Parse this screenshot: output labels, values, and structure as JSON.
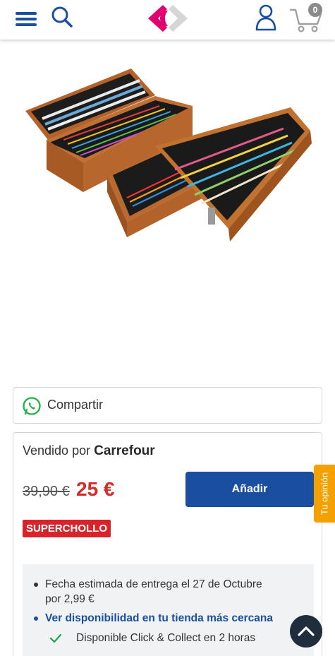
{
  "header": {
    "cart_count": "0"
  },
  "share": {
    "label": "Compartir"
  },
  "seller": {
    "prefix": "Vendido por",
    "name": "Carrefour"
  },
  "price": {
    "old": "39,90 €",
    "current": "25 €"
  },
  "add_button": "Añadir",
  "badge": "SUPERCHOLLO",
  "delivery": {
    "estimate": "Fecha estimada de entrega el 27 de Octubre por 2,99 €",
    "store_link": "Ver disponibilidad en tu tienda más cercana",
    "click_collect": "Disponible Click & Collect en 2 horas"
  },
  "feedback_tab": "Tu opinión",
  "colors": {
    "brand_blue": "#1a4ea0",
    "price_red": "#d42b2b",
    "badge_red": "#d8232a",
    "feedback_orange": "#f4a100"
  }
}
